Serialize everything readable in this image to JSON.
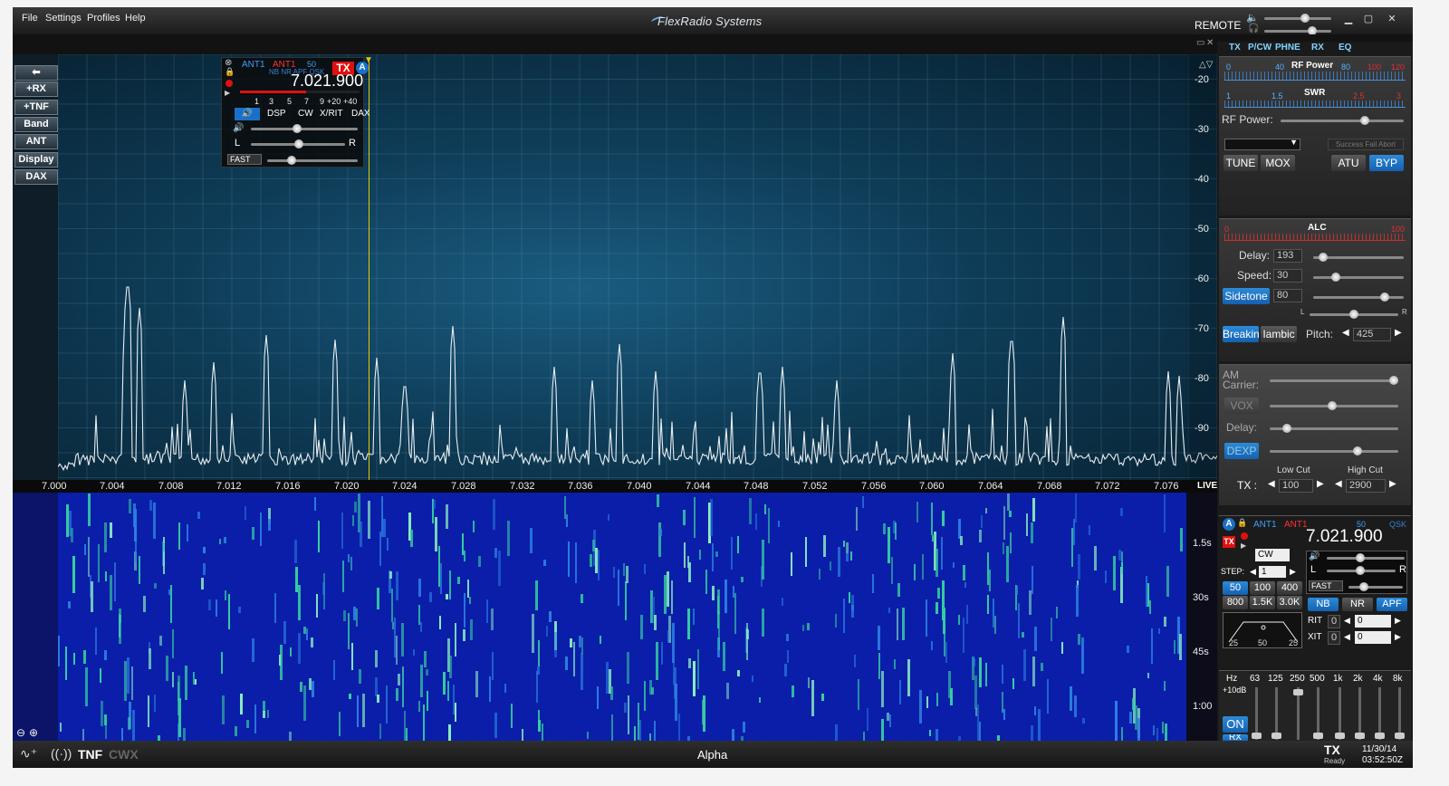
{
  "menu": {
    "file": "File",
    "settings": "Settings",
    "profiles": "Profiles",
    "help": "Help"
  },
  "brand": "FlexRadio Systems",
  "remote_label": "REMOTE",
  "left_buttons": [
    "+RX",
    "+TNF",
    "Band",
    "ANT",
    "Display",
    "DAX"
  ],
  "slice": {
    "ant_rx": "ANT1",
    "ant_tx": "ANT1",
    "filter": "50",
    "flags": "NB NR APF QSK",
    "tx_badge": "TX",
    "letter": "A",
    "frequency": "7.021.900",
    "s_ticks": [
      "1",
      "3",
      "5",
      "7",
      "9",
      "+20",
      "+40"
    ],
    "tabs": [
      "DSP",
      "CW",
      "X/RIT",
      "DAX"
    ],
    "agc": "FAST",
    "pan_l": "L",
    "pan_r": "R"
  },
  "db_scale": [
    "-20",
    "-30",
    "-40",
    "-50",
    "-60",
    "-70",
    "-80",
    "-90"
  ],
  "freq_axis": [
    "7.000",
    "7.004",
    "7.008",
    "7.012",
    "7.016",
    "7.020",
    "7.024",
    "7.028",
    "7.032",
    "7.036",
    "7.040",
    "7.044",
    "7.048",
    "7.052",
    "7.056",
    "7.060",
    "7.064",
    "7.068",
    "7.072",
    "7.076"
  ],
  "live_label": "LIVE",
  "time_scale": [
    "1.5s",
    "30s",
    "45s",
    "1:00"
  ],
  "status": {
    "tnf": "TNF",
    "cwx": "CWX",
    "station": "Alpha",
    "tx_label": "TX",
    "tx_state": "Ready",
    "date": "11/30/14",
    "time": "03:52:50Z"
  },
  "right_tabs": [
    "TX",
    "P/CW",
    "PHNE",
    "RX",
    "EQ"
  ],
  "tx_panel": {
    "rf_meter": "RF Power",
    "rf_ticks": [
      "0",
      "40",
      "80",
      "100",
      "120"
    ],
    "swr_meter": "SWR",
    "swr_ticks": [
      "1",
      "1.5",
      "2.5",
      "3"
    ],
    "rf_power_label": "RF Power:",
    "atu_status": "Success Fail Abort",
    "tune": "TUNE",
    "mox": "MOX",
    "atu": "ATU",
    "byp": "BYP"
  },
  "cw_panel": {
    "alc": "ALC",
    "alc_ticks": [
      "0",
      "100"
    ],
    "delay_label": "Delay:",
    "delay": "193",
    "speed_label": "Speed:",
    "speed": "30",
    "sidetone": "Sidetone",
    "sidetone_val": "80",
    "l": "L",
    "r": "R",
    "breakin": "Breakin",
    "iambic": "Iambic",
    "pitch_label": "Pitch:",
    "pitch": "425"
  },
  "phone_panel": {
    "am_carrier": "AM Carrier:",
    "vox": "VOX",
    "delay_label": "Delay:",
    "dexp": "DEXP",
    "low_cut_label": "Low Cut",
    "high_cut_label": "High Cut",
    "tx_label": "TX :",
    "low_cut": "100",
    "high_cut": "2900"
  },
  "rx_panel": {
    "ant_rx": "ANT1",
    "ant_tx": "ANT1",
    "filter": "50",
    "qsk": "QSK",
    "letter": "A",
    "tx_badge": "TX",
    "frequency": "7.021.900",
    "mode": "CW",
    "step_label": "STEP:",
    "step": "1",
    "filters": [
      "50",
      "100",
      "400",
      "800",
      "1.5K",
      "3.0K"
    ],
    "nb": "NB",
    "nr": "NR",
    "apf": "APF",
    "agc": "FAST",
    "rit_label": "RIT",
    "rit_on": "0",
    "rit": "0",
    "xit_label": "XIT",
    "xit_on": "0",
    "xit": "0",
    "shape_ticks": [
      "25",
      "50",
      "25"
    ],
    "l": "L",
    "r": "R"
  },
  "eq_panel": {
    "bands": [
      "Hz",
      "63",
      "125",
      "250",
      "500",
      "1k",
      "2k",
      "4k",
      "8k"
    ],
    "gain": "+10dB",
    "on": "ON",
    "rx": "RX"
  }
}
